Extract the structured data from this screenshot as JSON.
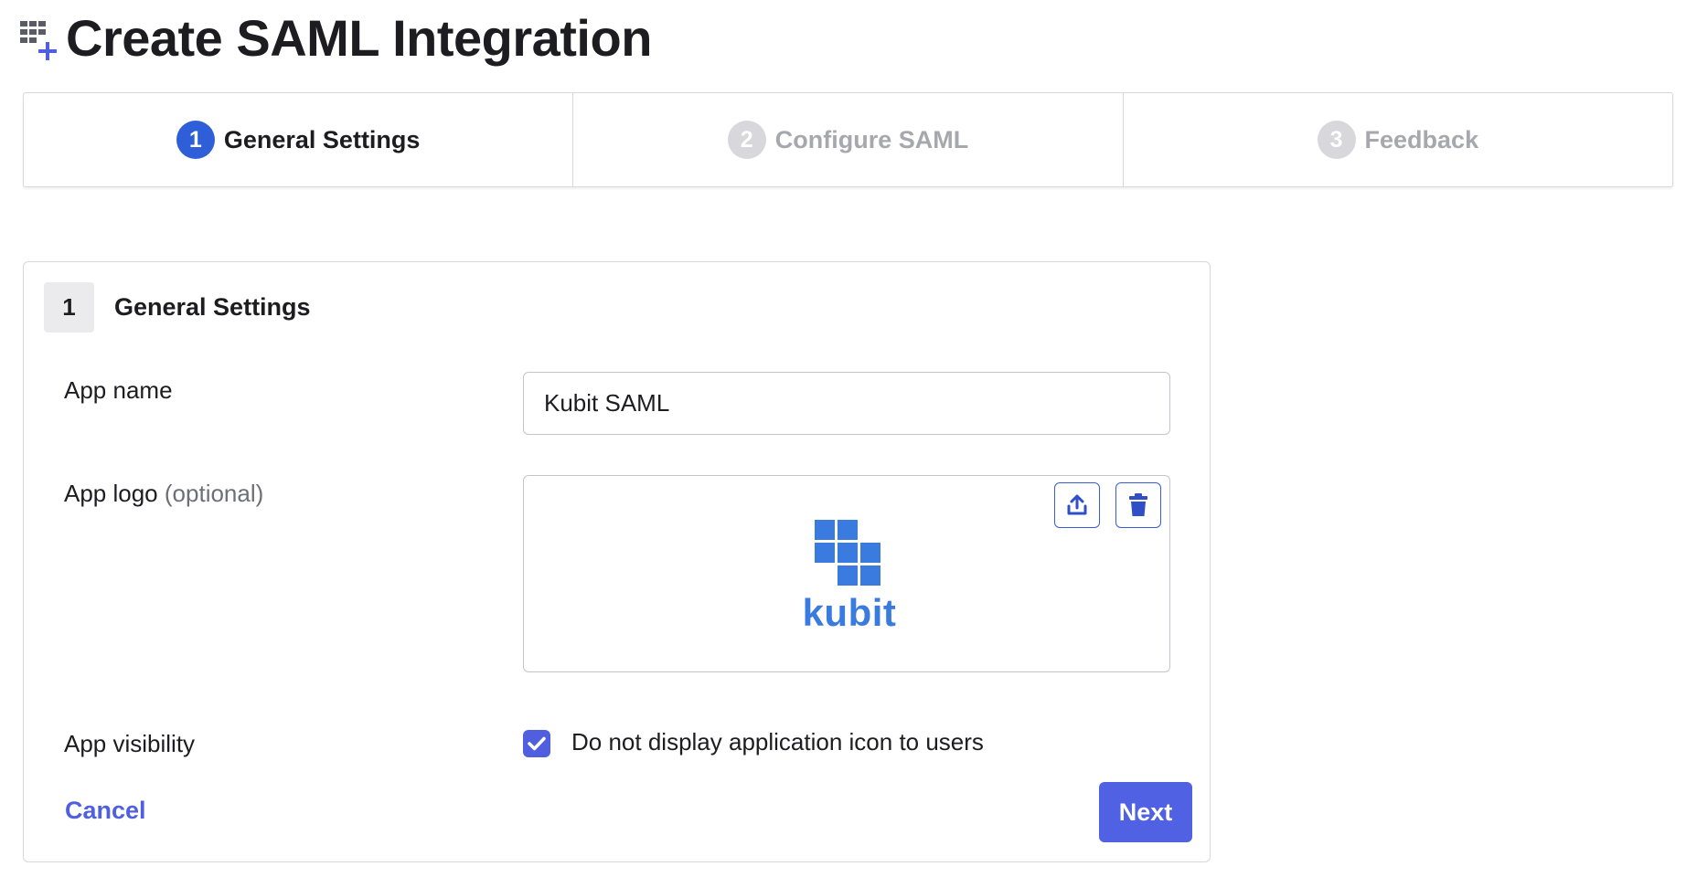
{
  "page": {
    "title": "Create SAML Integration",
    "header_icon": "app-add-icon"
  },
  "stepper": {
    "steps": [
      {
        "number": "1",
        "label": "General Settings",
        "state": "active"
      },
      {
        "number": "2",
        "label": "Configure SAML",
        "state": "inactive"
      },
      {
        "number": "3",
        "label": "Feedback",
        "state": "inactive"
      }
    ]
  },
  "section": {
    "number": "1",
    "title": "General Settings"
  },
  "form": {
    "app_name": {
      "label": "App name",
      "value": "Kubit SAML"
    },
    "app_logo": {
      "label": "App logo",
      "optional_label": "(optional)",
      "logo_text": "kubit",
      "upload_icon": "upload-icon",
      "delete_icon": "trash-icon"
    },
    "app_visibility": {
      "label": "App visibility",
      "checkbox_label": "Do not display application icon to users",
      "checked": true
    }
  },
  "actions": {
    "cancel_label": "Cancel",
    "next_label": "Next"
  },
  "colors": {
    "accent": "#5062e3",
    "active_step": "#2f5fd8",
    "inactive_step": "#d7d7dc",
    "logo_blue": "#3a7be0"
  }
}
